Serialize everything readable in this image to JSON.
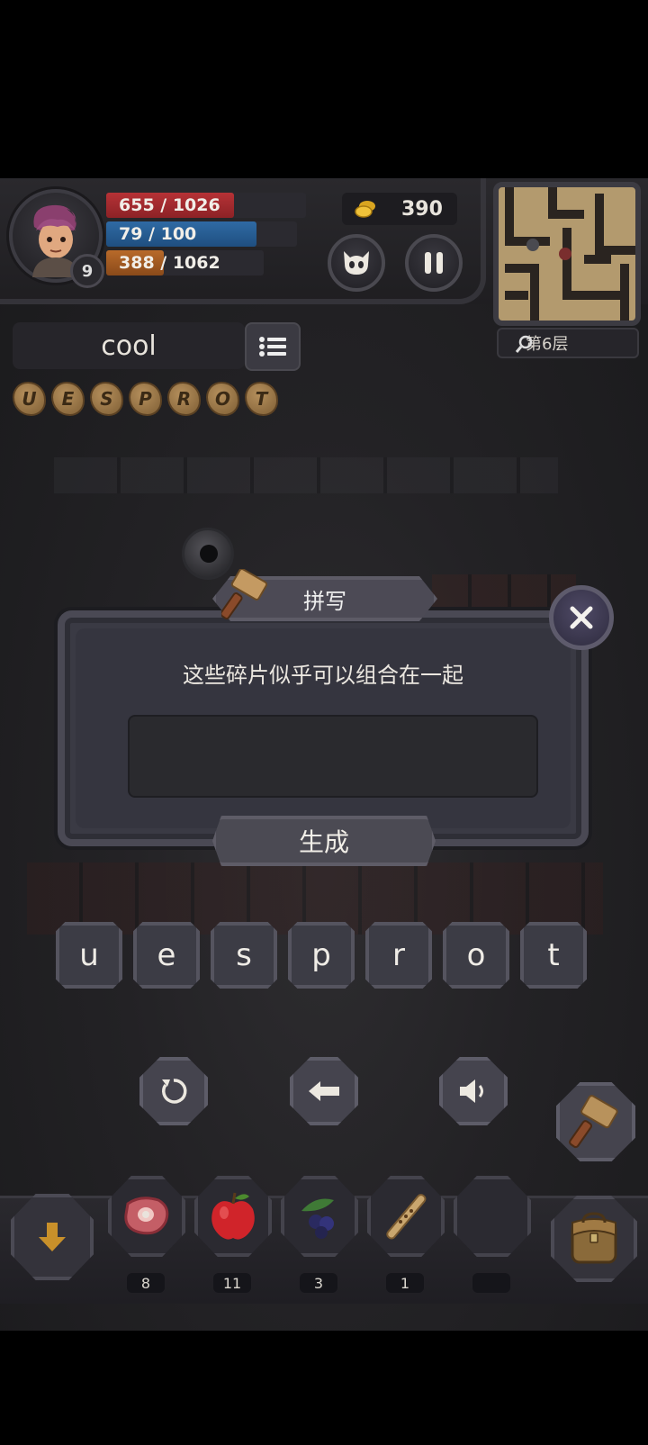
{
  "player": {
    "level": "9",
    "hp": {
      "text": "655 / 1026",
      "fraction": 0.638
    },
    "mp": {
      "text": "79 / 100",
      "fraction": 0.79
    },
    "xp": {
      "text": "388 / 1062",
      "fraction": 0.365
    }
  },
  "coins": "390",
  "minimap": {
    "floor_label": "第6层"
  },
  "word_box": {
    "value": "cool"
  },
  "shards": [
    "U",
    "E",
    "S",
    "P",
    "R",
    "O",
    "T"
  ],
  "dialog": {
    "title": "拼写",
    "message": "这些碎片似乎可以组合在一起",
    "answer_value": "",
    "generate_label": "生成"
  },
  "letters": [
    "u",
    "e",
    "s",
    "p",
    "r",
    "o",
    "t"
  ],
  "inventory": [
    {
      "item": "meat-icon",
      "count": "8"
    },
    {
      "item": "apple-icon",
      "count": "11"
    },
    {
      "item": "berries-icon",
      "count": "3"
    },
    {
      "item": "flute-icon",
      "count": "1"
    },
    {
      "item": "empty",
      "count": ""
    }
  ],
  "colors": {
    "hp": "#b63236",
    "mp": "#2f6aa4",
    "xp": "#b86a2a",
    "panel": "#3a3a44"
  }
}
